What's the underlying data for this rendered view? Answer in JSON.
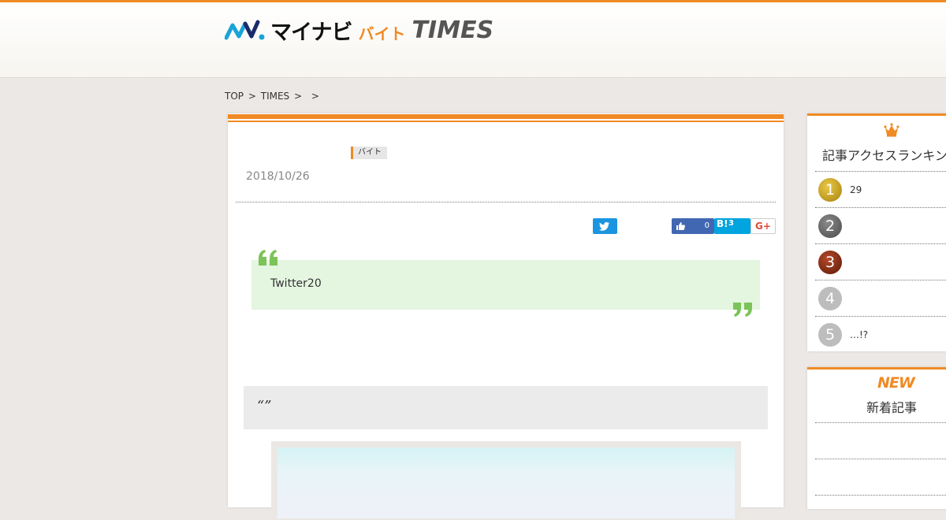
{
  "header": {
    "logo_mynavi": "マイナビ",
    "logo_baito": "バイト",
    "logo_times": "TIMES"
  },
  "breadcrumb": {
    "top": "TOP",
    "sep1": ">",
    "times": "TIMES",
    "sep2": ">",
    "sep3": ">"
  },
  "article": {
    "category": "バイト",
    "date": "2018/10/26",
    "share": {
      "like_count": "0",
      "hatena_label": "B!",
      "hatena_count": "3",
      "gplus_label": "G+"
    },
    "quote_text": "Twitter20",
    "subhead": "“”"
  },
  "ranking": {
    "title": "記事アクセスランキング",
    "items": [
      {
        "rank": "1",
        "text": "29",
        "color": "#c9a21a"
      },
      {
        "rank": "2",
        "text": "",
        "color": "#666666"
      },
      {
        "rank": "3",
        "text": "",
        "color": "#8a2b10"
      },
      {
        "rank": "4",
        "text": "",
        "color": "#b8b8b8"
      },
      {
        "rank": "5",
        "text": "…!?",
        "color": "#b8b8b8"
      }
    ]
  },
  "new_articles": {
    "badge": "NEW",
    "title": "新着記事"
  },
  "colors": {
    "accent": "#f08a24",
    "quote_bg": "#e4f5e0",
    "quote_mark": "#7cc35a",
    "twitter": "#1b95e0",
    "facebook": "#4267b2",
    "hatena": "#00a4de"
  }
}
